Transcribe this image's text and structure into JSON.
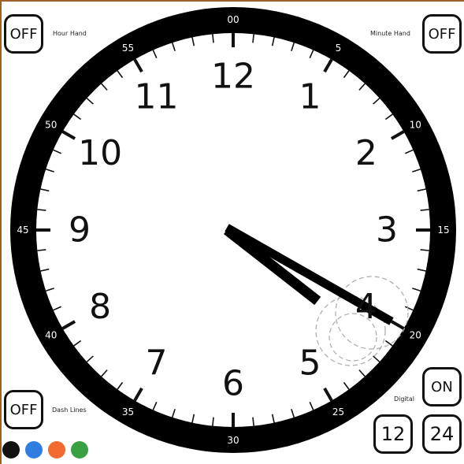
{
  "hour_hand_control": {
    "button_label": "OFF",
    "caption": "Hour Hand"
  },
  "minute_hand_control": {
    "button_label": "OFF",
    "caption": "Minute Hand"
  },
  "dash_lines_control": {
    "button_label": "OFF",
    "caption": "Dash Lines"
  },
  "digital_control": {
    "button_label": "ON",
    "caption": "Digital"
  },
  "format_buttons": {
    "twelve_label": "12",
    "twentyfour_label": "24"
  },
  "colors": {
    "swatches": [
      {
        "name": "black",
        "hex": "#111111"
      },
      {
        "name": "blue",
        "hex": "#2f7de1"
      },
      {
        "name": "orange",
        "hex": "#f26a2e"
      },
      {
        "name": "green",
        "hex": "#3aa044"
      }
    ],
    "bezel": "#000000",
    "face": "#ffffff"
  },
  "clock": {
    "hour_numbers": [
      "12",
      "1",
      "2",
      "3",
      "4",
      "5",
      "6",
      "7",
      "8",
      "9",
      "10",
      "11"
    ],
    "minute_labels": [
      "00",
      "5",
      "10",
      "15",
      "20",
      "25",
      "30",
      "35",
      "40",
      "45",
      "50",
      "55"
    ],
    "time_shown": {
      "hour": 4,
      "minute": 20
    }
  }
}
